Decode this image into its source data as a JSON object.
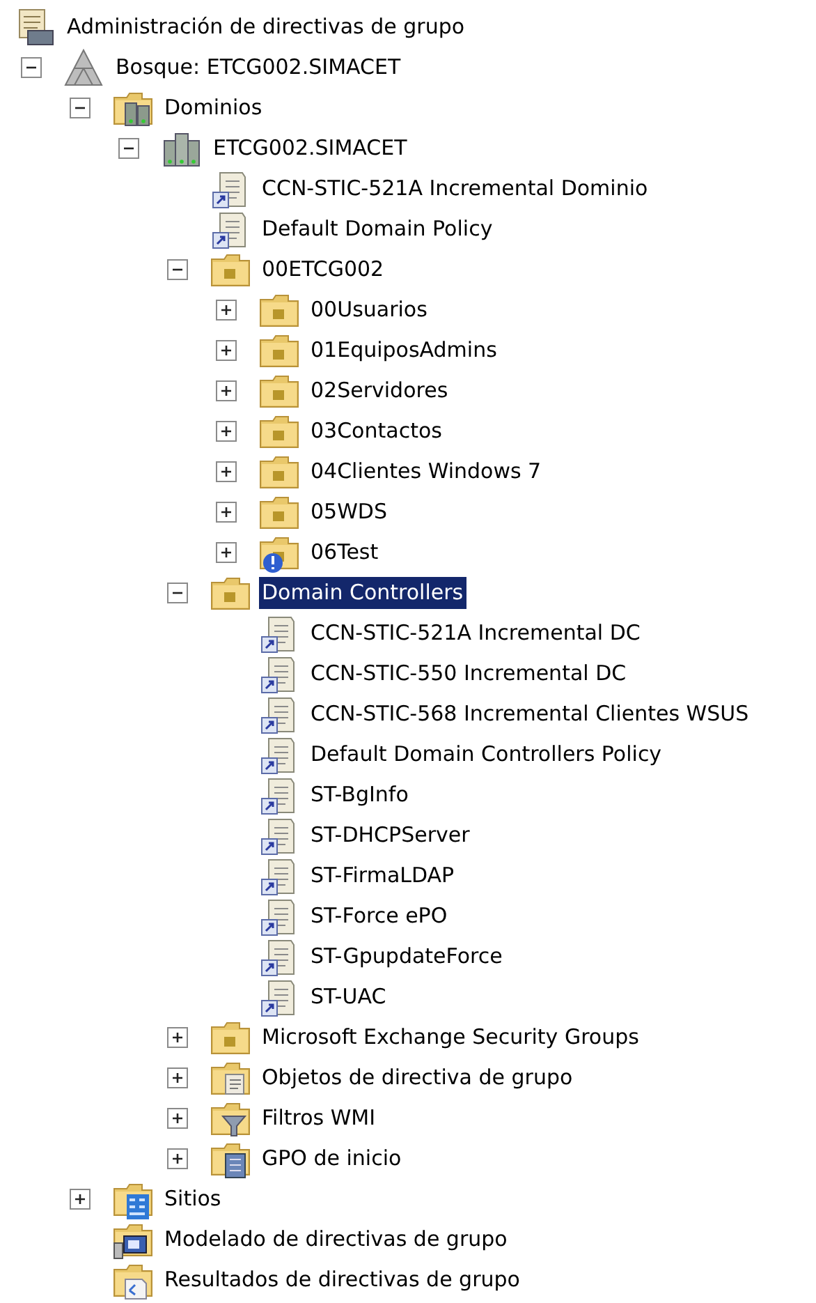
{
  "tree": [
    {
      "label": "Administración de directivas de grupo",
      "kind": "console",
      "selected": false,
      "children": [
        {
          "label": "Bosque: ETCG002.SIMACET",
          "kind": "forest",
          "expanded": true,
          "selected": false,
          "children": [
            {
              "label": "Dominios",
              "kind": "domains",
              "expanded": true,
              "selected": false,
              "children": [
                {
                  "label": "ETCG002.SIMACET",
                  "kind": "domain",
                  "expanded": true,
                  "selected": false,
                  "children": [
                    {
                      "label": "CCN-STIC-521A Incremental Dominio",
                      "kind": "gpo-link",
                      "selected": false
                    },
                    {
                      "label": "Default Domain Policy",
                      "kind": "gpo-link",
                      "selected": false
                    },
                    {
                      "label": "00ETCG002",
                      "kind": "ou",
                      "expanded": true,
                      "selected": false,
                      "children": [
                        {
                          "label": "00Usuarios",
                          "kind": "ou",
                          "expanded": false,
                          "selected": false
                        },
                        {
                          "label": "01EquiposAdmins",
                          "kind": "ou",
                          "expanded": false,
                          "selected": false
                        },
                        {
                          "label": "02Servidores",
                          "kind": "ou",
                          "expanded": false,
                          "selected": false
                        },
                        {
                          "label": "03Contactos",
                          "kind": "ou",
                          "expanded": false,
                          "selected": false
                        },
                        {
                          "label": "04Clientes Windows 7",
                          "kind": "ou",
                          "expanded": false,
                          "selected": false
                        },
                        {
                          "label": "05WDS",
                          "kind": "ou",
                          "expanded": false,
                          "selected": false
                        },
                        {
                          "label": "06Test",
                          "kind": "ou-warning",
                          "expanded": false,
                          "selected": false
                        }
                      ]
                    },
                    {
                      "label": "Domain Controllers",
                      "kind": "ou",
                      "expanded": true,
                      "selected": true,
                      "children": [
                        {
                          "label": "CCN-STIC-521A Incremental DC",
                          "kind": "gpo-link",
                          "selected": false
                        },
                        {
                          "label": "CCN-STIC-550 Incremental DC",
                          "kind": "gpo-link",
                          "selected": false
                        },
                        {
                          "label": "CCN-STIC-568 Incremental Clientes WSUS",
                          "kind": "gpo-link",
                          "selected": false
                        },
                        {
                          "label": "Default Domain Controllers Policy",
                          "kind": "gpo-link",
                          "selected": false
                        },
                        {
                          "label": "ST-BgInfo",
                          "kind": "gpo-link",
                          "selected": false
                        },
                        {
                          "label": "ST-DHCPServer",
                          "kind": "gpo-link",
                          "selected": false
                        },
                        {
                          "label": "ST-FirmaLDAP",
                          "kind": "gpo-link",
                          "selected": false
                        },
                        {
                          "label": "ST-Force ePO",
                          "kind": "gpo-link",
                          "selected": false
                        },
                        {
                          "label": "ST-GpupdateForce",
                          "kind": "gpo-link",
                          "selected": false
                        },
                        {
                          "label": "ST-UAC",
                          "kind": "gpo-link",
                          "selected": false
                        }
                      ]
                    },
                    {
                      "label": "Microsoft Exchange Security Groups",
                      "kind": "ou",
                      "expanded": false,
                      "selected": false
                    },
                    {
                      "label": "Objetos de directiva de grupo",
                      "kind": "gpo-folder",
                      "expanded": false,
                      "selected": false
                    },
                    {
                      "label": "Filtros WMI",
                      "kind": "filter-folder",
                      "expanded": false,
                      "selected": false
                    },
                    {
                      "label": "GPO de inicio",
                      "kind": "starter-folder",
                      "expanded": false,
                      "selected": false
                    }
                  ]
                }
              ]
            },
            {
              "label": "Sitios",
              "kind": "sites",
              "expanded": false,
              "selected": false
            },
            {
              "label": "Modelado de directivas de grupo",
              "kind": "modeling",
              "selected": false
            },
            {
              "label": "Resultados de directivas de grupo",
              "kind": "results",
              "selected": false
            }
          ]
        }
      ]
    }
  ]
}
